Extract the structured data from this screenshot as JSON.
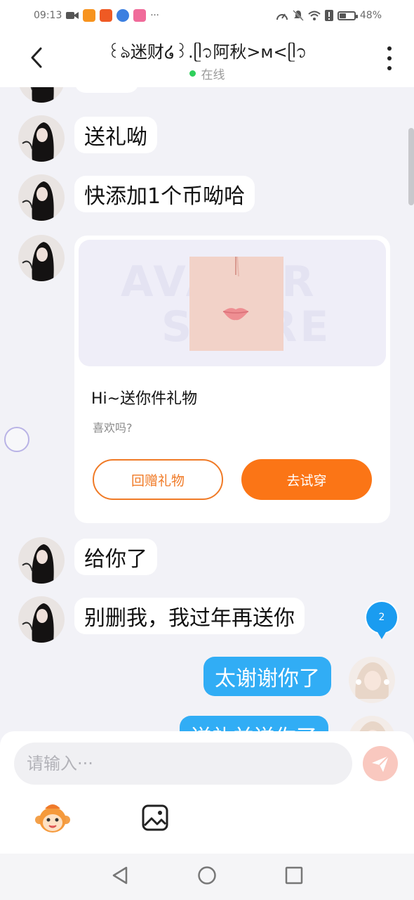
{
  "status_bar": {
    "time": "09:13",
    "battery": "48%",
    "battery_level": 0.48,
    "app_icons": [
      "video-icon",
      "youku-icon",
      "zcool-icon",
      "browser-icon",
      "bilibili-icon"
    ],
    "more": "···"
  },
  "header": {
    "title": "꒰ঌ迷财໒꒱.ᥫ᭡阿秋>ᴍ<ᥫ᭡",
    "status": "在线",
    "status_color": "#2fcf5b"
  },
  "messages": [
    {
      "side": "left",
      "text": "送礼呦"
    },
    {
      "side": "left",
      "text": "快添加1个币呦哈"
    },
    {
      "side": "left",
      "text": "给你了"
    },
    {
      "side": "left",
      "text": "别删我，我过年再送你"
    },
    {
      "side": "right",
      "text": "太谢谢你了"
    },
    {
      "side": "right",
      "text": "送礼並送你了"
    }
  ],
  "gift_card": {
    "watermark": "AVATAR\nSTORE",
    "title": "Hi~送你件礼物",
    "subtitle": "喜欢吗?",
    "return_gift_label": "回赠礼物",
    "try_on_label": "去试穿",
    "accent_color": "#fb7516"
  },
  "unread_badge": "2",
  "input": {
    "placeholder": "请输入···",
    "value": ""
  },
  "colors": {
    "bubble_right": "#31adf5",
    "background": "#f2f2f7"
  }
}
